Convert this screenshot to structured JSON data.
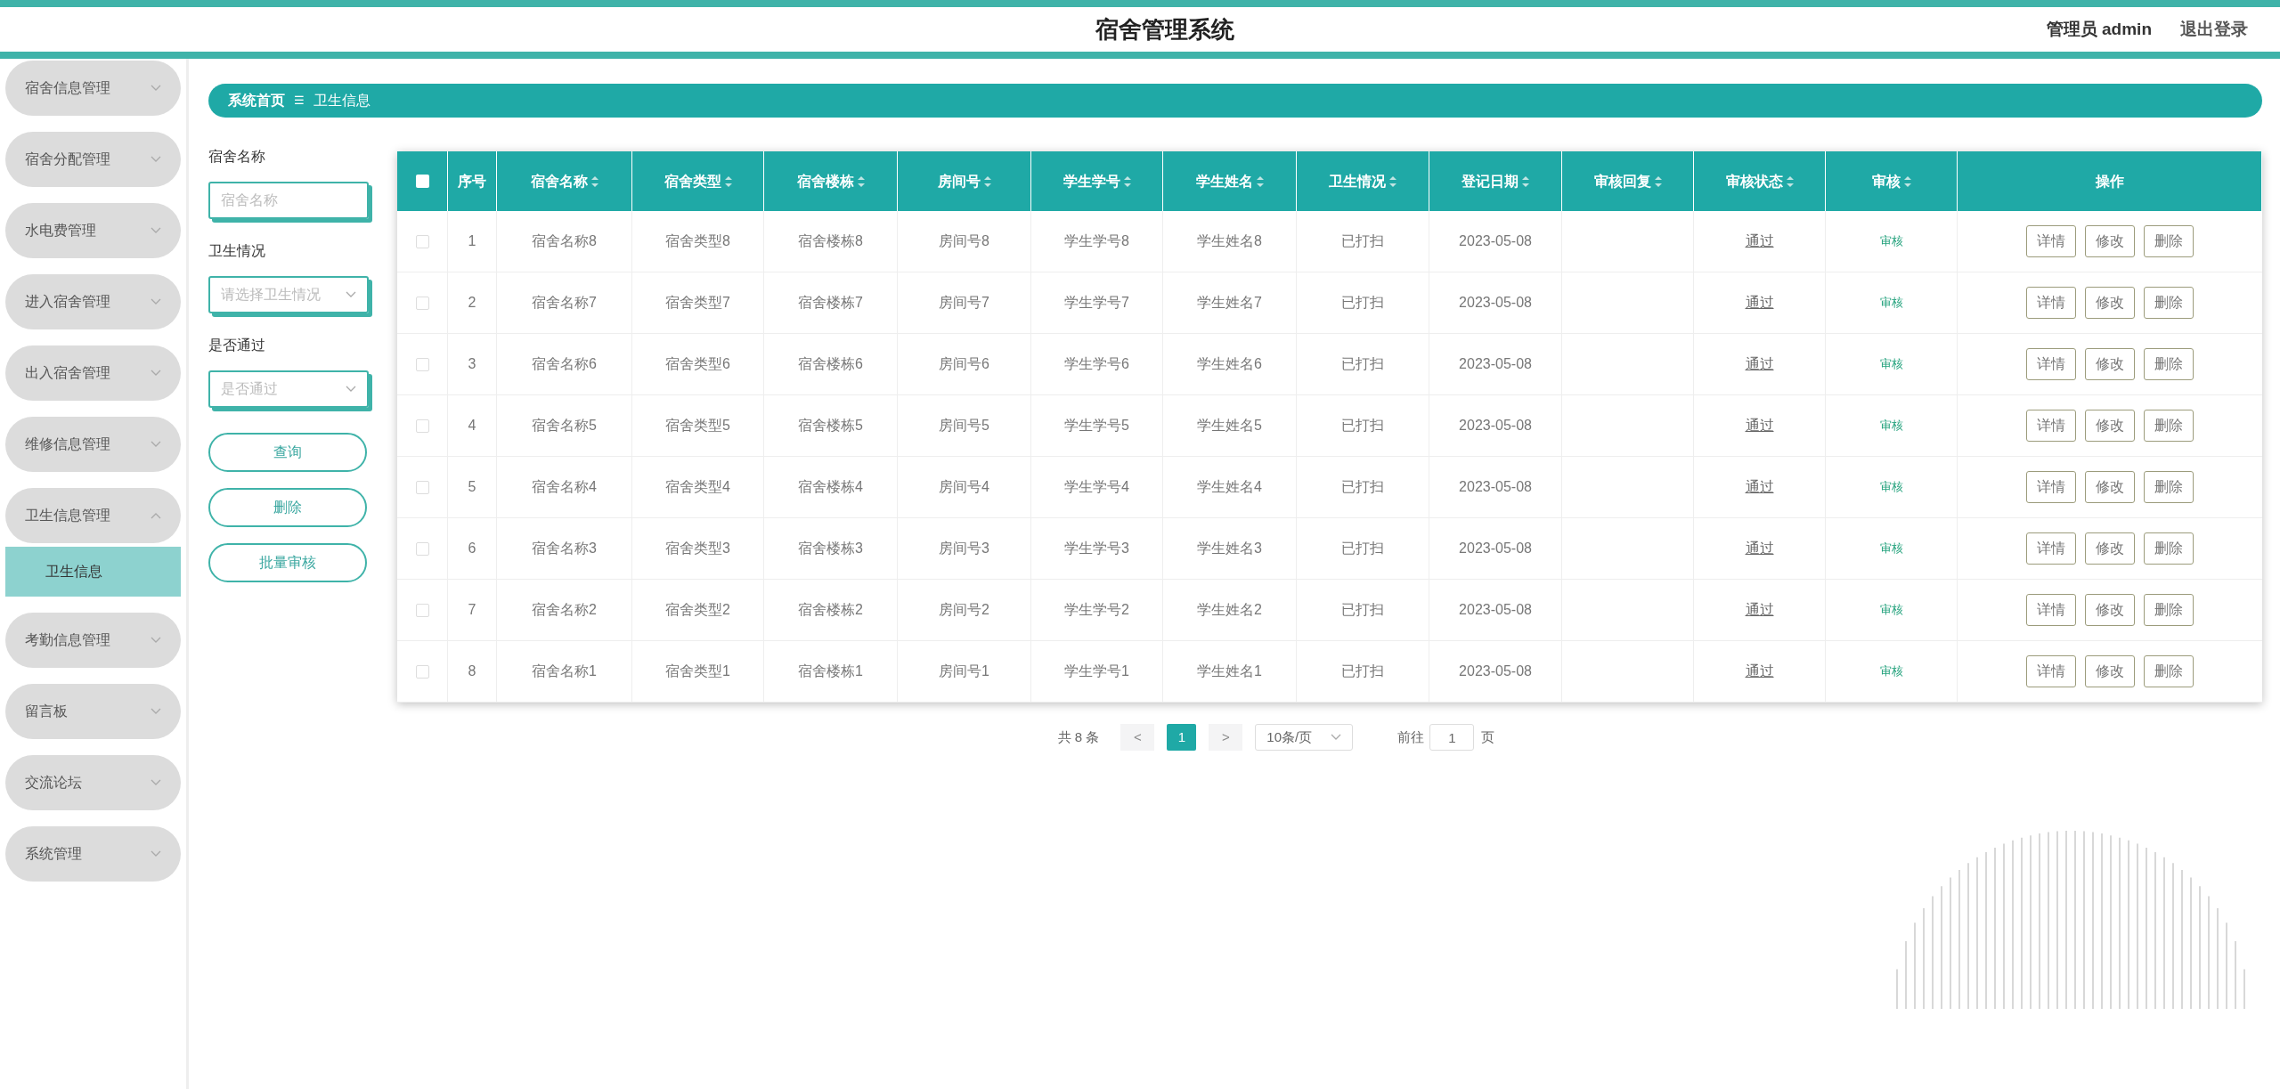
{
  "header": {
    "title": "宿舍管理系统",
    "user": "管理员 admin",
    "logout": "退出登录"
  },
  "sidebar": {
    "items": [
      {
        "label": "宿舍信息管理",
        "expanded": false
      },
      {
        "label": "宿舍分配管理",
        "expanded": false
      },
      {
        "label": "水电费管理",
        "expanded": false
      },
      {
        "label": "进入宿舍管理",
        "expanded": false
      },
      {
        "label": "出入宿舍管理",
        "expanded": false
      },
      {
        "label": "维修信息管理",
        "expanded": false
      },
      {
        "label": "卫生信息管理",
        "expanded": true,
        "children": [
          {
            "label": "卫生信息",
            "selected": true
          }
        ]
      },
      {
        "label": "考勤信息管理",
        "expanded": false
      },
      {
        "label": "留言板",
        "expanded": false
      },
      {
        "label": "交流论坛",
        "expanded": false
      },
      {
        "label": "系统管理",
        "expanded": false
      }
    ]
  },
  "breadcrumb": {
    "home": "系统首页",
    "separator": "☰",
    "current": "卫生信息"
  },
  "filters": [
    {
      "kind": "input",
      "label": "宿舍名称",
      "placeholder": "宿舍名称"
    },
    {
      "kind": "select",
      "label": "卫生情况",
      "placeholder": "请选择卫生情况"
    },
    {
      "kind": "select",
      "label": "是否通过",
      "placeholder": "是否通过"
    }
  ],
  "actions": [
    "查询",
    "删除",
    "批量审核"
  ],
  "table": {
    "select_all_checked": false,
    "columns": [
      {
        "label": "序号",
        "sortable": false
      },
      {
        "label": "宿舍名称",
        "sortable": true
      },
      {
        "label": "宿舍类型",
        "sortable": true
      },
      {
        "label": "宿舍楼栋",
        "sortable": true
      },
      {
        "label": "房间号",
        "sortable": true
      },
      {
        "label": "学生学号",
        "sortable": true
      },
      {
        "label": "学生姓名",
        "sortable": true
      },
      {
        "label": "卫生情况",
        "sortable": true
      },
      {
        "label": "登记日期",
        "sortable": true
      },
      {
        "label": "审核回复",
        "sortable": true
      },
      {
        "label": "审核状态",
        "sortable": true
      },
      {
        "label": "审核",
        "sortable": true
      },
      {
        "label": "操作",
        "sortable": false
      }
    ],
    "rows": [
      {
        "checked": false,
        "cells": [
          "1",
          "宿舍名称8",
          "宿舍类型8",
          "宿舍楼栋8",
          "房间号8",
          "学生学号8",
          "学生姓名8",
          "已打扫",
          "2023-05-08",
          "",
          "通过",
          "审核"
        ],
        "buttons": [
          "详情",
          "修改",
          "删除"
        ]
      },
      {
        "checked": false,
        "cells": [
          "2",
          "宿舍名称7",
          "宿舍类型7",
          "宿舍楼栋7",
          "房间号7",
          "学生学号7",
          "学生姓名7",
          "已打扫",
          "2023-05-08",
          "",
          "通过",
          "审核"
        ],
        "buttons": [
          "详情",
          "修改",
          "删除"
        ]
      },
      {
        "checked": false,
        "cells": [
          "3",
          "宿舍名称6",
          "宿舍类型6",
          "宿舍楼栋6",
          "房间号6",
          "学生学号6",
          "学生姓名6",
          "已打扫",
          "2023-05-08",
          "",
          "通过",
          "审核"
        ],
        "buttons": [
          "详情",
          "修改",
          "删除"
        ]
      },
      {
        "checked": false,
        "cells": [
          "4",
          "宿舍名称5",
          "宿舍类型5",
          "宿舍楼栋5",
          "房间号5",
          "学生学号5",
          "学生姓名5",
          "已打扫",
          "2023-05-08",
          "",
          "通过",
          "审核"
        ],
        "buttons": [
          "详情",
          "修改",
          "删除"
        ]
      },
      {
        "checked": false,
        "cells": [
          "5",
          "宿舍名称4",
          "宿舍类型4",
          "宿舍楼栋4",
          "房间号4",
          "学生学号4",
          "学生姓名4",
          "已打扫",
          "2023-05-08",
          "",
          "通过",
          "审核"
        ],
        "buttons": [
          "详情",
          "修改",
          "删除"
        ]
      },
      {
        "checked": false,
        "cells": [
          "6",
          "宿舍名称3",
          "宿舍类型3",
          "宿舍楼栋3",
          "房间号3",
          "学生学号3",
          "学生姓名3",
          "已打扫",
          "2023-05-08",
          "",
          "通过",
          "审核"
        ],
        "buttons": [
          "详情",
          "修改",
          "删除"
        ]
      },
      {
        "checked": false,
        "cells": [
          "7",
          "宿舍名称2",
          "宿舍类型2",
          "宿舍楼栋2",
          "房间号2",
          "学生学号2",
          "学生姓名2",
          "已打扫",
          "2023-05-08",
          "",
          "通过",
          "审核"
        ],
        "buttons": [
          "详情",
          "修改",
          "删除"
        ]
      },
      {
        "checked": false,
        "cells": [
          "8",
          "宿舍名称1",
          "宿舍类型1",
          "宿舍楼栋1",
          "房间号1",
          "学生学号1",
          "学生姓名1",
          "已打扫",
          "2023-05-08",
          "",
          "通过",
          "审核"
        ],
        "buttons": [
          "详情",
          "修改",
          "删除"
        ]
      }
    ]
  },
  "pagination": {
    "total": "共 8 条",
    "prev": "<",
    "pages": [
      {
        "label": "1",
        "selected": true
      }
    ],
    "next": ">",
    "page_size": "10条/页",
    "goto_label": "前往",
    "goto_value": "1",
    "goto_suffix": "页"
  }
}
